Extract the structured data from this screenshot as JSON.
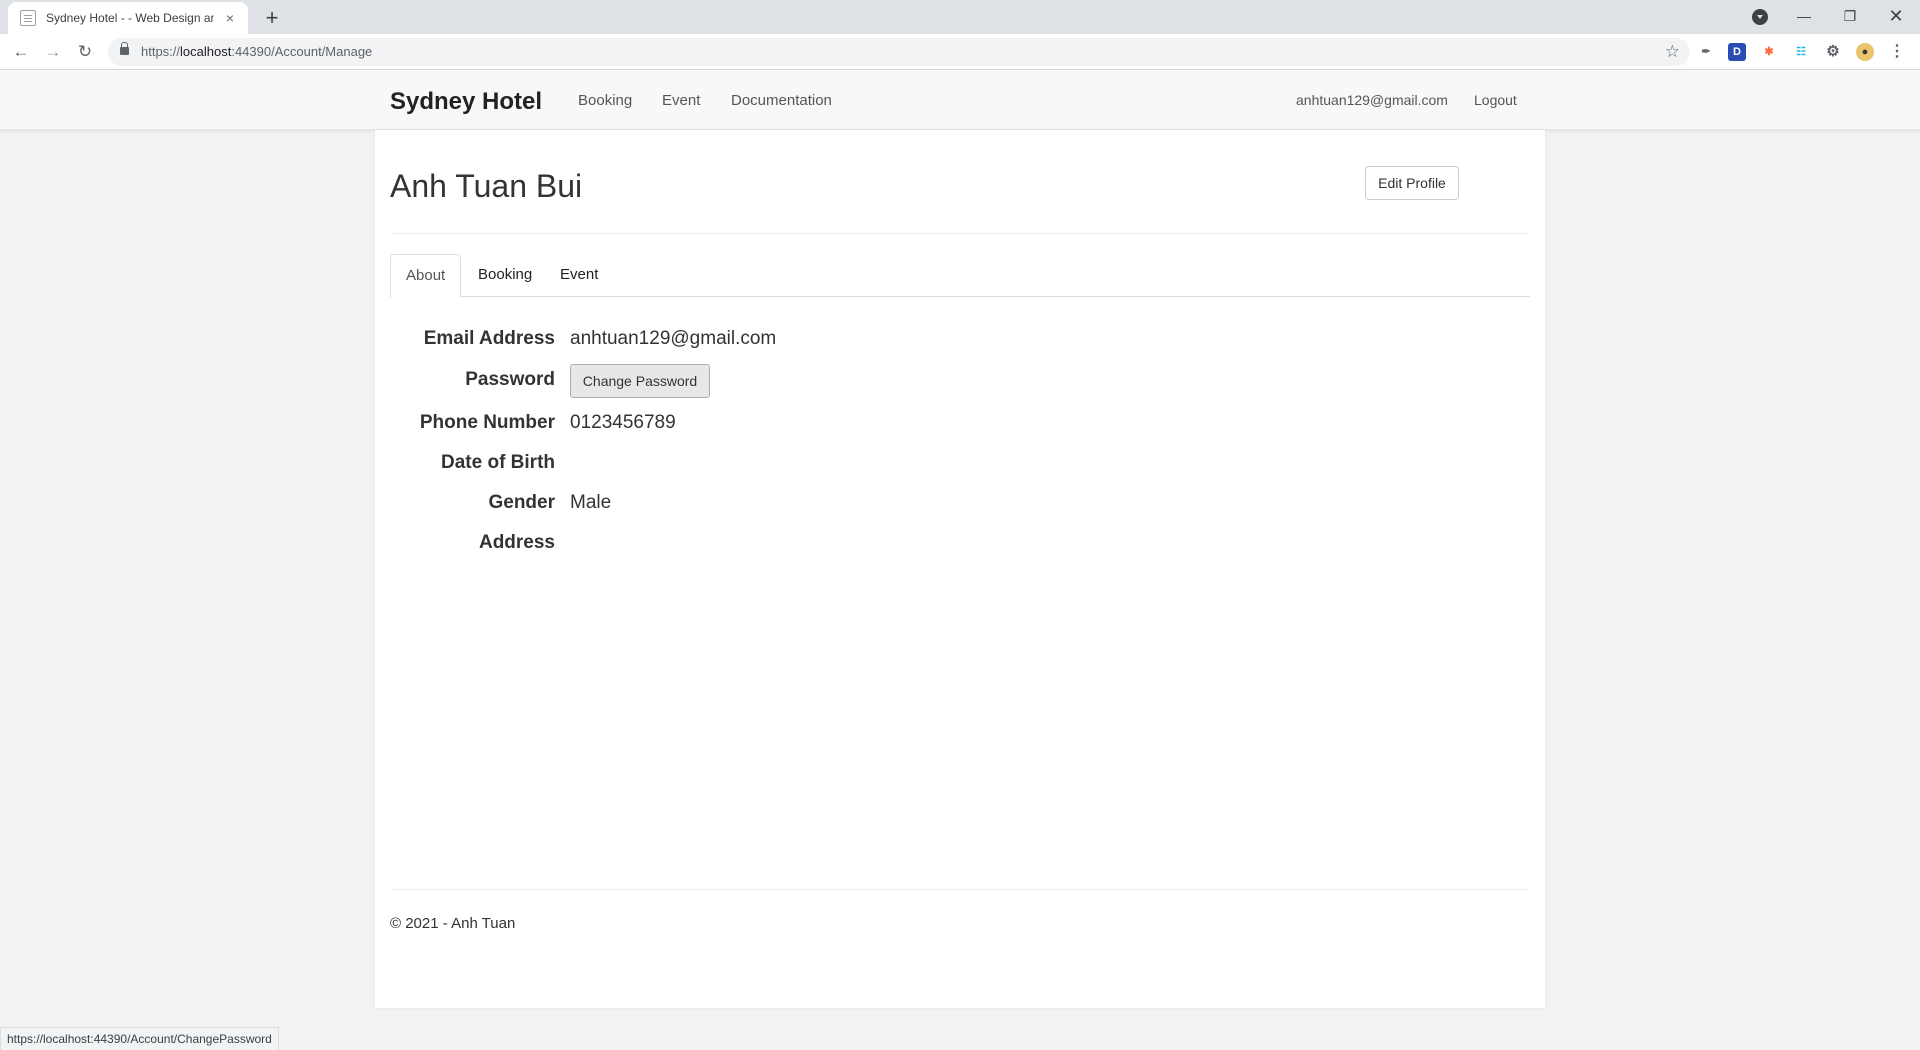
{
  "browser": {
    "tab_title": "Sydney Hotel - - Web Design and",
    "tab_close": "×",
    "new_tab": "+",
    "url_scheme": "https://",
    "url_host": "localhost",
    "url_rest": ":44390/Account/Manage",
    "status_url": "https://localhost:44390/Account/ChangePassword",
    "icons": {
      "back": "back-arrow-icon",
      "forward": "forward-arrow-icon",
      "reload": "reload-icon",
      "lock": "lock-icon",
      "star": "star-icon",
      "minimize": "minimize-icon",
      "maximize": "restore-icon",
      "close": "close-icon"
    }
  },
  "site": {
    "brand": "Sydney Hotel",
    "nav": [
      "Booking",
      "Event",
      "Documentation"
    ],
    "user_email": "anhtuan129@gmail.com",
    "logout": "Logout"
  },
  "profile": {
    "name": "Anh Tuan Bui",
    "edit_button": "Edit Profile",
    "tabs": [
      "About",
      "Booking",
      "Event"
    ],
    "active_tab": "About",
    "fields": {
      "email_label": "Email Address",
      "email_value": "anhtuan129@gmail.com",
      "password_label": "Password",
      "password_button": "Change Password",
      "phone_label": "Phone Number",
      "phone_value": "0123456789",
      "dob_label": "Date of Birth",
      "dob_value": "",
      "gender_label": "Gender",
      "gender_value": "Male",
      "address_label": "Address",
      "address_value": ""
    }
  },
  "footer": {
    "text": "© 2021 - Anh Tuan"
  },
  "colors": {
    "page_bg": "#f2f2f2",
    "navbar_bg": "#f8f8f8",
    "panel_bg": "#ffffff",
    "chrome_tabstrip": "#dee1e6"
  }
}
